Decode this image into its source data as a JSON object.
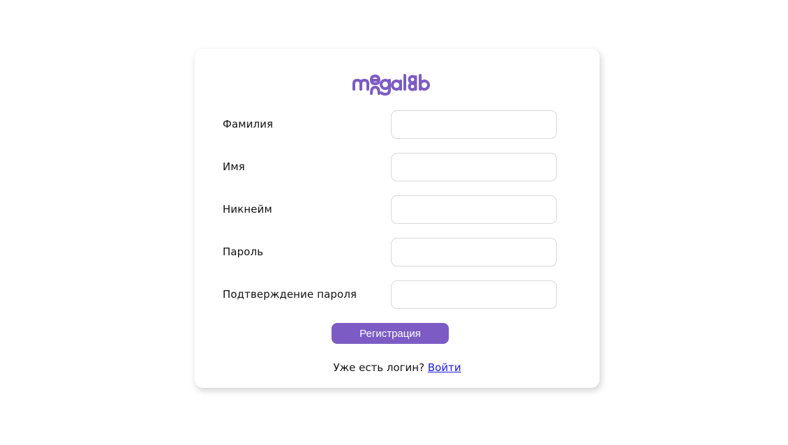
{
  "brand": {
    "logo_text": "megalab",
    "color": "#7c5cc4"
  },
  "form": {
    "fields": [
      {
        "label": "Фамилия",
        "value": "",
        "type": "text"
      },
      {
        "label": "Имя",
        "value": "",
        "type": "text"
      },
      {
        "label": "Никнейм",
        "value": "",
        "type": "text"
      },
      {
        "label": "Пароль",
        "value": "",
        "type": "password"
      },
      {
        "label": "Подтверждение пароля",
        "value": "",
        "type": "password"
      }
    ],
    "submit_label": "Регистрация"
  },
  "footer": {
    "prompt": "Уже есть логин?",
    "login_link": "Войти"
  }
}
